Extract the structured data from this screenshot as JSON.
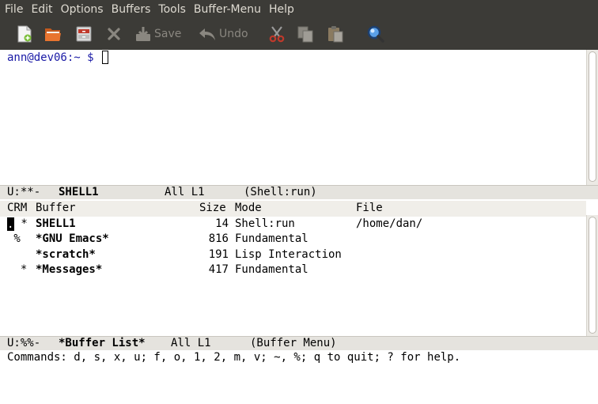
{
  "menu": [
    "File",
    "Edit",
    "Options",
    "Buffers",
    "Tools",
    "Buffer-Menu",
    "Help"
  ],
  "toolbar": {
    "save_label": "Save",
    "undo_label": "Undo"
  },
  "shell": {
    "prompt": "ann@dev06:~ $"
  },
  "modeline_top": {
    "status": "U:**-",
    "buffer": "SHELL1",
    "position": "All L1",
    "mode": "(Shell:run)"
  },
  "buffer_list": {
    "headers": {
      "crm": "CRM",
      "buffer": "Buffer",
      "size": "Size",
      "mode": "Mode",
      "file": "File"
    },
    "rows": [
      {
        "crm_cursor": ".",
        "crm_rest": " *",
        "name": "SHELL1",
        "size": "14",
        "mode": "Shell:run",
        "file": "/home/dan/"
      },
      {
        "crm_cursor": "",
        "crm_rest": " %",
        "name": "*GNU Emacs*",
        "size": "816",
        "mode": "Fundamental",
        "file": ""
      },
      {
        "crm_cursor": "",
        "crm_rest": "",
        "name": "*scratch*",
        "size": "191",
        "mode": "Lisp Interaction",
        "file": ""
      },
      {
        "crm_cursor": "",
        "crm_rest": "  *",
        "name": "*Messages*",
        "size": "417",
        "mode": "Fundamental",
        "file": ""
      }
    ]
  },
  "modeline_bottom": {
    "status": "U:%%-",
    "buffer": "*Buffer List*",
    "position": "All L1",
    "mode": "(Buffer Menu)"
  },
  "echo_area": "Commands: d, s, x, u; f, o, 1, 2, m, v; ~, %; q to quit; ? for help."
}
